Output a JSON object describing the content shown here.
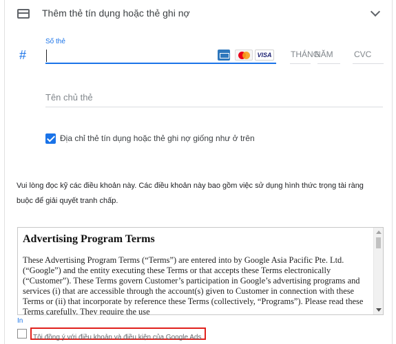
{
  "header": {
    "icon": "credit-card-icon",
    "title": "Thêm thẻ tín dụng hoặc thẻ ghi nợ",
    "toggle_icon": "chevron-down-icon"
  },
  "card_number": {
    "icon": "hash-icon",
    "icon_glyph": "#",
    "label": "Số thẻ",
    "value": "",
    "brands": [
      "American Express",
      "MasterCard",
      "VISA"
    ],
    "visa_text": "VISA"
  },
  "expiry": {
    "month_placeholder": "THÁNG",
    "year_placeholder": "NĂM"
  },
  "cvc": {
    "placeholder": "CVC"
  },
  "cardholder": {
    "placeholder": "Tên chủ thẻ"
  },
  "same_address": {
    "checked": true,
    "label": "Địa chỉ thẻ tín dụng hoặc thẻ ghi nợ giống như ở trên"
  },
  "notice": {
    "text": "Vui lòng đọc kỹ các điều khoản này. Các điều khoản này bao gồm việc sử dụng hình thức trọng tài ràng buộc để giải quyết tranh chấp."
  },
  "terms": {
    "heading": "Advertising Program Terms",
    "body": "These Advertising Program Terms (“Terms”) are entered into by Google Asia Pacific Pte. Ltd.  (“Google”) and the entity executing these Terms or that accepts these Terms electronically (“Customer”).  These Terms govern Customer’s participation in Google’s advertising programs and services (i) that are accessible through the account(s) given to Customer in connection with these Terms or (ii) that incorporate by reference these Terms (collectively, “Programs”).  Please read these Terms carefully.  They require the use"
  },
  "stray_text": "In",
  "agree": {
    "checked": false,
    "label": "Tôi đồng ý với điều khoản và điều kiện của Google Ads"
  },
  "colors": {
    "accent": "#1a73e8",
    "highlight_border": "#e0201b"
  }
}
